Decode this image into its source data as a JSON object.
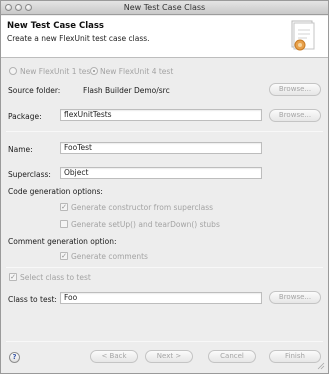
{
  "window": {
    "title": "New Test Case Class"
  },
  "header": {
    "title": "New Test Case Class",
    "description": "Create a new FlexUnit test case class."
  },
  "version": {
    "option_flexunit1": "New FlexUnit 1 test",
    "option_flexunit4": "New FlexUnit 4 test",
    "selected": "New FlexUnit 4 test"
  },
  "source_folder": {
    "label": "Source folder:",
    "value": "Flash Builder Demo/src",
    "browse": "Browse..."
  },
  "package": {
    "label": "Package:",
    "value": "flexUnitTests",
    "browse": "Browse..."
  },
  "name": {
    "label": "Name:",
    "value": "FooTest"
  },
  "superclass": {
    "label": "Superclass:",
    "value": "Object"
  },
  "code_generation": {
    "label": "Code generation options:",
    "generate_constructor": "Generate constructor from superclass",
    "generate_constructor_checked": true,
    "generate_setup": "Generate setUp() and tearDown() stubs",
    "generate_setup_checked": false
  },
  "comment_generation": {
    "label": "Comment generation option:",
    "generate_comments": "Generate comments",
    "generate_comments_checked": true
  },
  "select_class": {
    "label": "Select class to test",
    "checked": true
  },
  "class_to_test": {
    "label": "Class to test:",
    "value": "Foo",
    "browse": "Browse..."
  },
  "footer": {
    "help": "?",
    "back": "< Back",
    "next": "Next >",
    "cancel": "Cancel",
    "finish": "Finish"
  },
  "check_mark": "✓"
}
